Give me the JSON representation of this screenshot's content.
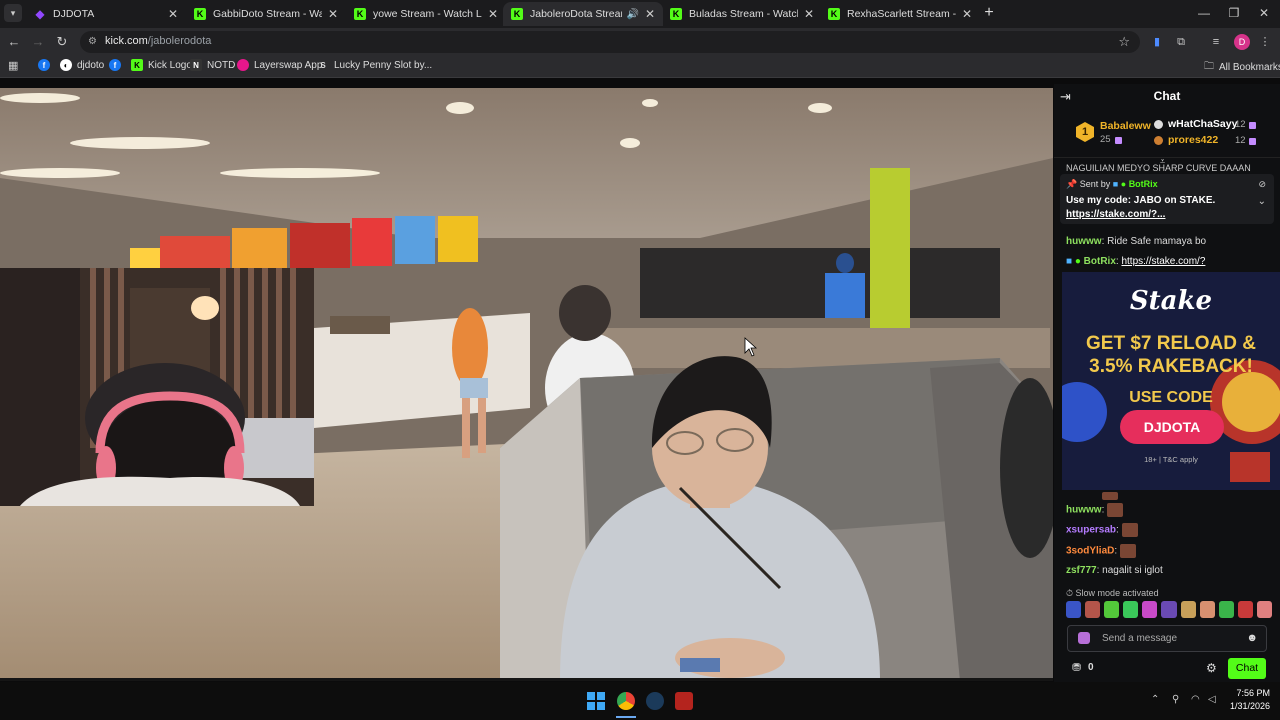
{
  "browser": {
    "tabs": [
      {
        "title": "DJDOTA",
        "favicon": "twitch-icon",
        "active": false
      },
      {
        "title": "GabbiDoto Stream - Watch Live",
        "favicon": "kick-icon",
        "active": false
      },
      {
        "title": "yowe Stream - Watch Live on K",
        "favicon": "kick-icon",
        "active": false
      },
      {
        "title": "JaboleroDota Stream - Watc",
        "favicon": "kick-icon",
        "active": true
      },
      {
        "title": "Buladas Stream - Watch Live or",
        "favicon": "kick-icon",
        "active": false
      },
      {
        "title": "RexhaScarlett Stream - Watch L",
        "favicon": "kick-icon",
        "active": false
      }
    ],
    "url_host": "kick.com",
    "url_path": "/jabolerodota",
    "profile_initial": "D",
    "bookmarks": [
      {
        "label": "",
        "icon": "facebook-icon"
      },
      {
        "label": "djdoto",
        "icon": "github-icon"
      },
      {
        "label": "",
        "icon": "facebook-icon"
      },
      {
        "label": "Kick Logo",
        "icon": "kick-icon"
      },
      {
        "label": "NOTD",
        "icon": "notd-icon"
      },
      {
        "label": "Layerswap App",
        "icon": "layerswap-icon"
      },
      {
        "label": "Lucky Penny Slot by...",
        "icon": "s-icon"
      }
    ],
    "all_bookmarks": "All Bookmarks"
  },
  "chat": {
    "title": "Chat",
    "leaderboard": {
      "first": {
        "rank": "1",
        "name": "Babaleww",
        "count": "25"
      },
      "second": {
        "name": "wHatChaSayy",
        "count": "12"
      },
      "third": {
        "name": "prores422",
        "count": "12"
      }
    },
    "truncated_line": "NAGUILIAN MEDYO SHARP CURVE DAAAN",
    "pinned": {
      "sent_by": "Sent by",
      "bot_name": "BotRix",
      "message": "Use my code: JABO on STAKE.",
      "link": "https://stake.com/?..."
    },
    "messages_top": [
      {
        "user": "huwww",
        "text": "Ride Safe mamaya bo",
        "color": "#8ee05f"
      },
      {
        "user": "BotRix",
        "text": "https://stake.com/?",
        "color": "#8ee05f"
      }
    ],
    "ad": {
      "logo": "Stake",
      "headline_1": "GET $7 RELOAD &",
      "headline_2": "3.5% RAKEBACK!",
      "use_code": "USE CODE",
      "code": "DJDOTA",
      "fine_print": "18+ | T&C apply"
    },
    "messages_bottom": [
      {
        "user": "huwww",
        "text": "",
        "color": "#8ee05f"
      },
      {
        "user": "xsupersab",
        "text": "",
        "color": "#b47cff"
      },
      {
        "user": "3sodYliaD",
        "text": "",
        "color": "#ff8a3d"
      },
      {
        "user": "zsf777",
        "text": "nagalit si iglot",
        "color": "#8ee05f"
      }
    ],
    "slow_mode": "Slow mode activated",
    "input_placeholder": "Send a message",
    "points": "0",
    "send_label": "Chat"
  },
  "taskbar": {
    "time": "7:56 PM",
    "date": "1/31/2026"
  },
  "colors": {
    "kick_green": "#53fc18",
    "chat_bg": "#0f1012",
    "accent_pink": "#e62e5c"
  }
}
